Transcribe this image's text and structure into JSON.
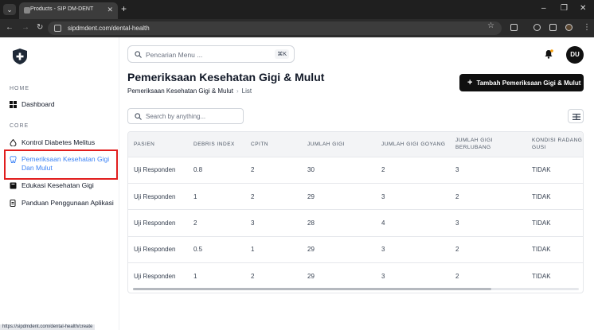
{
  "browser": {
    "tab_title": "Products - SIP DM-DENT",
    "url": "sipdmdent.com/dental-health",
    "status_url": "https://sipdmdent.com/dental-health/create"
  },
  "sidebar": {
    "section_home": "HOME",
    "section_core": "CORE",
    "items": [
      {
        "label": "Dashboard"
      },
      {
        "label": "Kontrol Diabetes Melitus"
      },
      {
        "label": "Pemeriksaan Kesehatan Gigi Dan Mulut"
      },
      {
        "label": "Edukasi Kesehatan Gigi"
      },
      {
        "label": "Panduan Penggunaan Aplikasi"
      }
    ]
  },
  "header": {
    "search_placeholder": "Pencarian Menu ...",
    "shortcut": "⌘K",
    "avatar": "DU"
  },
  "page": {
    "title": "Pemeriksaan Kesehatan Gigi & Mulut",
    "breadcrumb": [
      "Pemeriksaan Kesehatan Gigi & Mulut",
      "List"
    ],
    "add_button": "Tambah Pemeriksaan Gigi & Mulut",
    "table_search_placeholder": "Search by anything..."
  },
  "table": {
    "columns": [
      "PASIEN",
      "DEBRIS INDEX",
      "CPITN",
      "JUMLAH GIGI",
      "JUMLAH GIGI GOYANG",
      "JUMLAH GIGI BERLUBANG",
      "KONDISI RADANG GUSI"
    ],
    "rows": [
      [
        "Uji Responden",
        "0.8",
        "2",
        "30",
        "2",
        "3",
        "TIDAK"
      ],
      [
        "Uji Responden",
        "1",
        "2",
        "29",
        "3",
        "2",
        "TIDAK"
      ],
      [
        "Uji Responden",
        "2",
        "3",
        "28",
        "4",
        "3",
        "TIDAK"
      ],
      [
        "Uji Responden",
        "0.5",
        "1",
        "29",
        "3",
        "2",
        "TIDAK"
      ],
      [
        "Uji Responden",
        "1",
        "2",
        "29",
        "3",
        "2",
        "TIDAK"
      ]
    ]
  }
}
